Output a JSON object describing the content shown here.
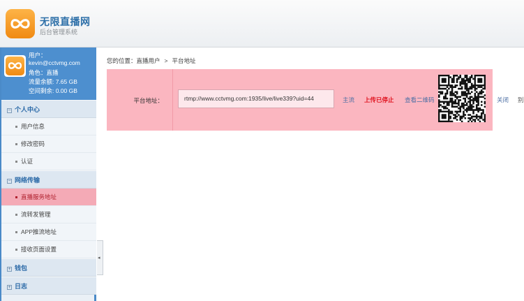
{
  "header": {
    "brand_title": "无限直播网",
    "brand_subtitle": "后台管理系统"
  },
  "user": {
    "label_user": "用户：",
    "email": "kevin@cctvmg.com",
    "role": "角色：直播",
    "traffic": "流量余额: 7.65 GB",
    "space": "空间剩余: 0.00 GB"
  },
  "menu": {
    "groups": [
      {
        "label": "个人中心",
        "marker": "−",
        "items": [
          "用户信息",
          "修改密码",
          "认证"
        ]
      },
      {
        "label": "网络传输",
        "marker": "−",
        "items": [
          "直播服务地址",
          "流转发管理",
          "APP推流地址",
          "接收页面设置"
        ]
      },
      {
        "label": "钱包",
        "marker": "+",
        "items": []
      },
      {
        "label": "日志",
        "marker": "+",
        "items": []
      }
    ],
    "active_item": "直播服务地址"
  },
  "breadcrumb": {
    "prefix": "您的位置：",
    "level1": "直播用户",
    "separator": ">",
    "level2": "平台地址"
  },
  "platform_row": {
    "label": "平台地址：",
    "url": "rtmp://www.cctvmg.com:1935/live/live339?uid=44",
    "link_main": "主流",
    "link_status": "上传已停止",
    "link_qr": "查看二维码",
    "close": "关闭",
    "other": "别"
  },
  "colors": {
    "accent_blue": "#4a8ac8",
    "highlight_pink": "#fbb6c0",
    "status_red": "#e0121e",
    "logo_orange": "#f39a1f"
  },
  "icons": {
    "logo": "infinity-logo-icon",
    "group_expanded": "minus-box-icon",
    "group_collapsed": "plus-box-icon",
    "collapse": "caret-left-icon"
  }
}
